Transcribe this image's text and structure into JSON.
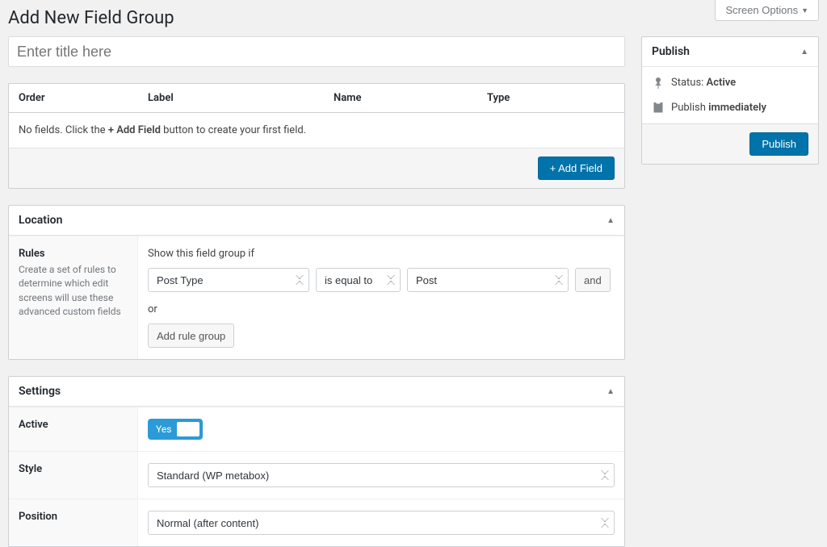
{
  "top": {
    "screen_options_label": "Screen Options"
  },
  "header": {
    "page_title": "Add New Field Group",
    "title_placeholder": "Enter title here"
  },
  "fields": {
    "columns": {
      "order": "Order",
      "label": "Label",
      "name": "Name",
      "type": "Type"
    },
    "empty_prefix": "No fields. Click the ",
    "empty_bold": "+ Add Field",
    "empty_suffix": " button to create your first field.",
    "add_field_btn": "+ Add Field"
  },
  "location": {
    "box_title": "Location",
    "rules_title": "Rules",
    "rules_desc": "Create a set of rules to determine which edit screens will use these advanced custom fields",
    "show_if_label": "Show this field group if",
    "param": "Post Type",
    "operator": "is equal to",
    "value": "Post",
    "and_btn": "and",
    "or_label": "or",
    "add_group_btn": "Add rule group"
  },
  "settings": {
    "box_title": "Settings",
    "active_label": "Active",
    "active_value": "Yes",
    "style_label": "Style",
    "style_value": "Standard (WP metabox)",
    "position_label": "Position",
    "position_value": "Normal (after content)"
  },
  "publish": {
    "box_title": "Publish",
    "status_label": "Status: ",
    "status_value": "Active",
    "schedule_label": "Publish ",
    "schedule_value": "immediately",
    "publish_btn": "Publish"
  }
}
